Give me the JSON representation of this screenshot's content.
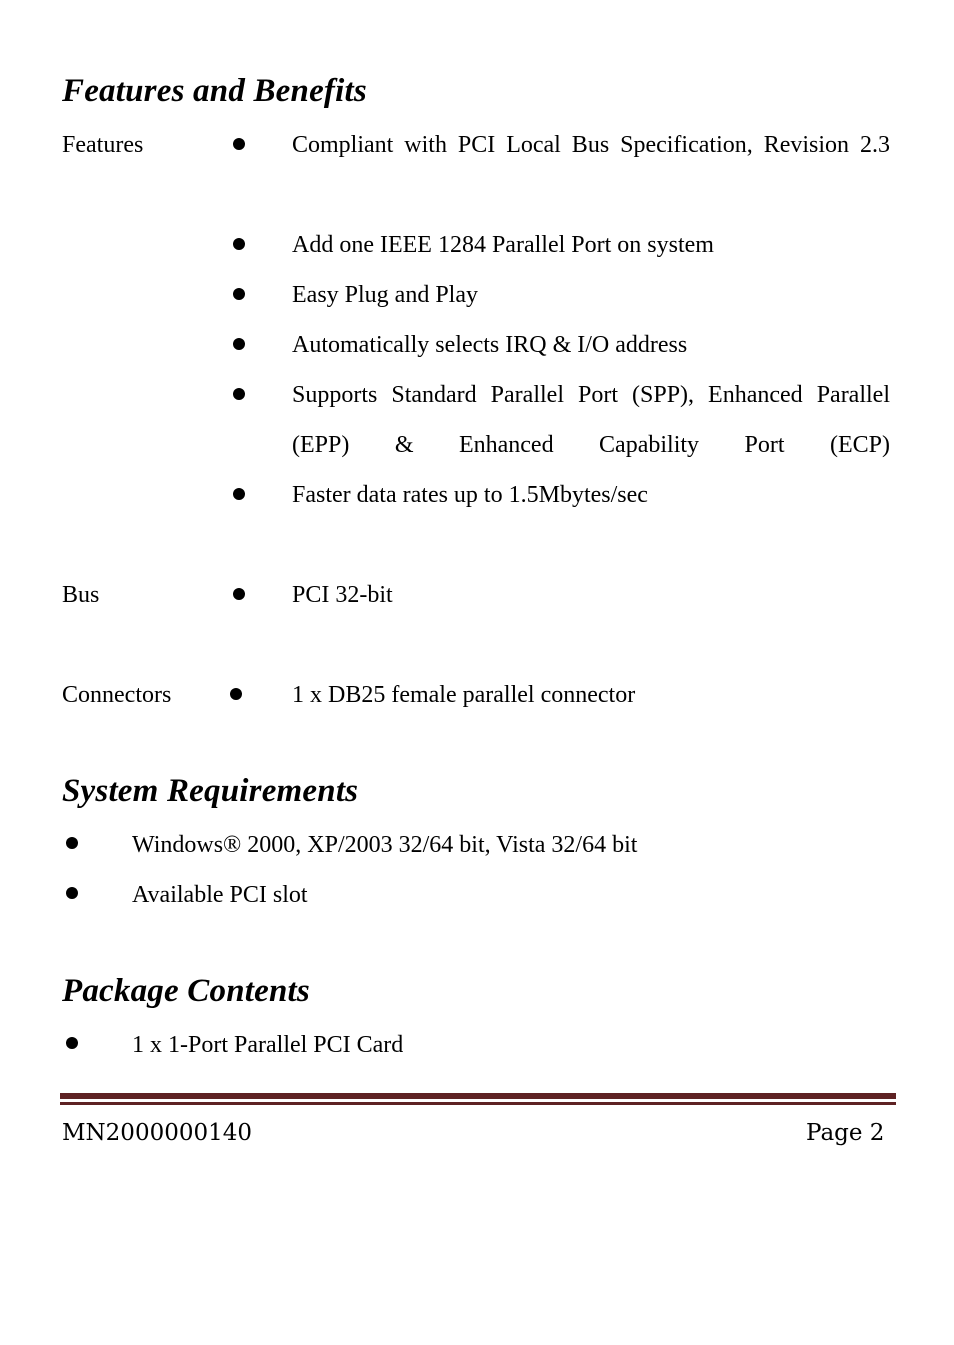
{
  "document": {
    "sections": [
      {
        "id": "features-and-benefits",
        "heading": "Features and Benefits",
        "rows": [
          {
            "label": "Features",
            "bullet": "●",
            "text": "Compliant with PCI Local Bus Specification, Revision 2.3"
          },
          {
            "label": "",
            "bullet": "●",
            "text": "Add one IEEE 1284 Parallel Port on system"
          },
          {
            "label": "",
            "bullet": "●",
            "text": "Easy Plug and Play"
          },
          {
            "label": "",
            "bullet": "●",
            "text": "Automatically selects IRQ & I/O address"
          },
          {
            "label": "",
            "bullet": "●",
            "text": "Supports Standard Parallel Port (SPP), Enhanced Parallel (EPP) & Enhanced Capability Port (ECP)"
          },
          {
            "label": "",
            "bullet": "●",
            "text": "Faster data rates up to 1.5Mbytes/sec"
          },
          {
            "label": "Bus",
            "bullet": "●",
            "text": "PCI 32-bit"
          },
          {
            "label": "Connectors",
            "bullet": "●",
            "text": "1 x DB25 female parallel connector"
          }
        ]
      },
      {
        "id": "system-requirements",
        "heading": "System Requirements",
        "items": [
          {
            "bullet": "●",
            "text": "Windows® 2000, XP/2003 32/64 bit, Vista 32/64 bit"
          },
          {
            "bullet": "●",
            "text": "Available PCI slot"
          }
        ]
      },
      {
        "id": "package-contents",
        "heading": "Package Contents",
        "items": [
          {
            "bullet": "●",
            "text": "1 x 1-Port Parallel PCI Card"
          }
        ]
      }
    ]
  },
  "footer": {
    "document_number": "MN2000000140",
    "page_label": "Page 2",
    "rule_color": "#5E2223"
  }
}
